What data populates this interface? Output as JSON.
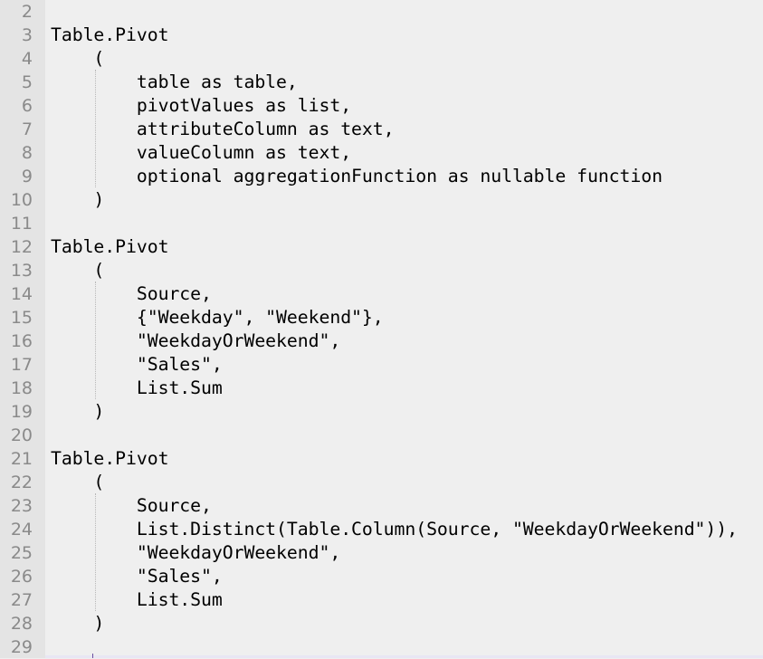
{
  "editor": {
    "lines": [
      {
        "number": "2",
        "text": ""
      },
      {
        "number": "3",
        "text": "Table.Pivot"
      },
      {
        "number": "4",
        "text": "    ("
      },
      {
        "number": "5",
        "text": "        table as table,"
      },
      {
        "number": "6",
        "text": "        pivotValues as list,"
      },
      {
        "number": "7",
        "text": "        attributeColumn as text,"
      },
      {
        "number": "8",
        "text": "        valueColumn as text,"
      },
      {
        "number": "9",
        "text": "        optional aggregationFunction as nullable function"
      },
      {
        "number": "10",
        "text": "    )"
      },
      {
        "number": "11",
        "text": ""
      },
      {
        "number": "12",
        "text": "Table.Pivot"
      },
      {
        "number": "13",
        "text": "    ("
      },
      {
        "number": "14",
        "text": "        Source,"
      },
      {
        "number": "15",
        "text": "        {\"Weekday\", \"Weekend\"},"
      },
      {
        "number": "16",
        "text": "        \"WeekdayOrWeekend\","
      },
      {
        "number": "17",
        "text": "        \"Sales\","
      },
      {
        "number": "18",
        "text": "        List.Sum"
      },
      {
        "number": "19",
        "text": "    )"
      },
      {
        "number": "20",
        "text": ""
      },
      {
        "number": "21",
        "text": "Table.Pivot"
      },
      {
        "number": "22",
        "text": "    ("
      },
      {
        "number": "23",
        "text": "        Source,"
      },
      {
        "number": "24",
        "text": "        List.Distinct(Table.Column(Source, \"WeekdayOrWeekend\")),"
      },
      {
        "number": "25",
        "text": "        \"WeekdayOrWeekend\","
      },
      {
        "number": "26",
        "text": "        \"Sales\","
      },
      {
        "number": "27",
        "text": "        List.Sum"
      },
      {
        "number": "28",
        "text": "    )"
      },
      {
        "number": "29",
        "text": ""
      }
    ]
  }
}
